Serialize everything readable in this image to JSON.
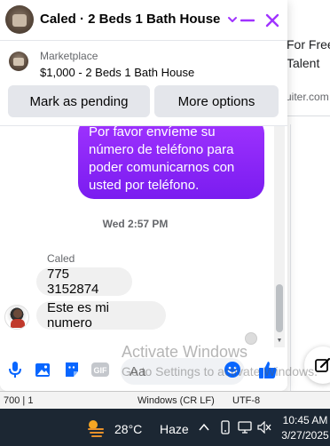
{
  "background": {
    "right_line1": "For Free",
    "right_line2": "Talent",
    "right_url": "uiter.com"
  },
  "chat": {
    "title": "Caled · 2 Beds 1 Bath House",
    "accent_color": "#a033ff",
    "listing": {
      "label": "Marketplace",
      "value": "$1,000 - 2 Beds 1 Bath House"
    },
    "actions": {
      "mark_pending": "Mark as pending",
      "more_options": "More options"
    },
    "messages": {
      "outgoing_text": "Por favor envíeme su número de teléfono para poder comunicarnos con usted por teléfono.",
      "timestamp": "Wed 2:57 PM",
      "sender_name": "Caled",
      "incoming_1": "775 3152874",
      "incoming_2": "Este es mi numero"
    },
    "composer": {
      "placeholder": "Aa"
    }
  },
  "watermark": {
    "line1": "Activate Windows",
    "line2": "Go to Settings to activate Windows."
  },
  "taskbar_strip": {
    "c1": "700 | 1",
    "c2": "Windows (CR LF)",
    "c3": "UTF-8"
  },
  "taskbar": {
    "temperature": "28°C",
    "condition": "Haze",
    "time": "10:45 AM",
    "date": "3/27/2025"
  },
  "icons": [
    "chevron-down-icon",
    "minimize-icon",
    "close-icon",
    "microphone-icon",
    "photo-icon",
    "sticker-icon",
    "gif-icon",
    "emoji-icon",
    "thumbs-up-icon",
    "compose-icon",
    "weather-icon",
    "tray-chevron-icon",
    "phone-link-icon",
    "network-icon",
    "volume-icon"
  ]
}
